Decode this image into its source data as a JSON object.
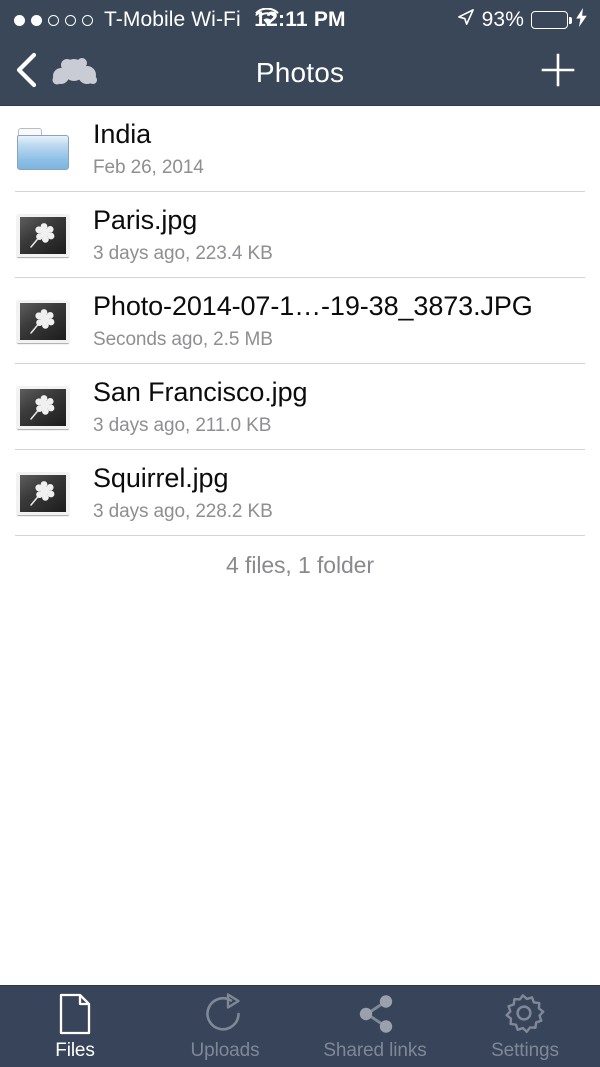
{
  "status_bar": {
    "signal_dots_filled": 2,
    "signal_dots_total": 5,
    "carrier": "T-Mobile Wi-Fi",
    "wifi_icon": "wifi-icon",
    "time": "12:11 PM",
    "location_icon": "location-arrow-icon",
    "battery_percent": "93%",
    "battery_level": 93,
    "charging_icon": "lightning-bolt-icon",
    "battery_color": "#4cd964"
  },
  "nav_bar": {
    "back_icon": "chevron-left-icon",
    "app_logo_icon": "owncloud-cloud-icon",
    "title": "Photos",
    "add_icon": "plus-icon",
    "background_color": "#3a4758"
  },
  "list": {
    "rows": [
      {
        "icon": "folder-icon",
        "type": "folder",
        "name": "India",
        "detail": "Feb 26, 2014"
      },
      {
        "icon": "image-file-icon",
        "type": "image",
        "name": "Paris.jpg",
        "detail": "3 days ago, 223.4 KB"
      },
      {
        "icon": "image-file-icon",
        "type": "image",
        "name": "Photo-2014-07-1…-19-38_3873.JPG",
        "detail": "Seconds ago, 2.5 MB"
      },
      {
        "icon": "image-file-icon",
        "type": "image",
        "name": "San Francisco.jpg",
        "detail": "3 days ago, 211.0 KB"
      },
      {
        "icon": "image-file-icon",
        "type": "image",
        "name": "Squirrel.jpg",
        "detail": "3 days ago, 228.2 KB"
      }
    ],
    "summary": "4 files, 1 folder"
  },
  "tab_bar": {
    "background_color": "#374459",
    "active_color": "#ffffff",
    "inactive_color": "#7f8896",
    "tabs": [
      {
        "icon": "document-icon",
        "label": "Files",
        "active": true
      },
      {
        "icon": "refresh-arrow-icon",
        "label": "Uploads",
        "active": false
      },
      {
        "icon": "share-nodes-icon",
        "label": "Shared links",
        "active": false
      },
      {
        "icon": "gear-icon",
        "label": "Settings",
        "active": false
      }
    ]
  }
}
